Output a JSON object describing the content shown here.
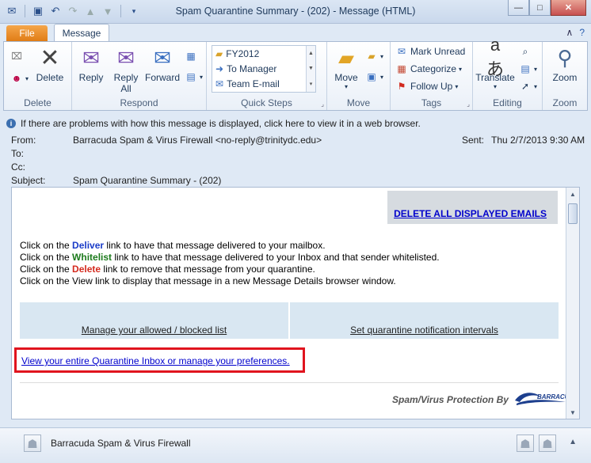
{
  "window": {
    "title": "Spam Quarantine Summary - (202)  -  Message (HTML)"
  },
  "tabs": {
    "file": "File",
    "message": "Message"
  },
  "ribbon": {
    "delete_group": {
      "delete_label": "Delete",
      "group_label": "Delete"
    },
    "respond_group": {
      "reply": "Reply",
      "reply_all_line1": "Reply",
      "reply_all_line2": "All",
      "forward": "Forward",
      "group_label": "Respond"
    },
    "quick_steps": {
      "items": [
        "FY2012",
        "To Manager",
        "Team E-mail"
      ],
      "group_label": "Quick Steps"
    },
    "move_group": {
      "move": "Move",
      "group_label": "Move"
    },
    "tags_group": {
      "mark_unread": "Mark Unread",
      "categorize": "Categorize",
      "follow_up": "Follow Up",
      "group_label": "Tags"
    },
    "editing_group": {
      "translate": "Translate",
      "group_label": "Editing"
    },
    "zoom_group": {
      "zoom": "Zoom",
      "group_label": "Zoom"
    }
  },
  "infobar": {
    "text": "If there are problems with how this message is displayed, click here to view it in a web browser."
  },
  "headers": {
    "from_label": "From:",
    "from_value": "Barracuda Spam & Virus Firewall <no-reply@trinitydc.edu>",
    "sent_label": "Sent:",
    "sent_value": "Thu 2/7/2013 9:30 AM",
    "to_label": "To:",
    "cc_label": "Cc:",
    "subject_label": "Subject:",
    "subject_value": "Spam Quarantine Summary - (202)"
  },
  "body": {
    "delete_all": "DELETE ALL DISPLAYED EMAILS",
    "instructions": {
      "line1_prefix": "Click on the ",
      "line1_word": "Deliver",
      "line1_suffix": " link to have that message delivered to your mailbox.",
      "line2_prefix": "Click on the ",
      "line2_word": "Whitelist",
      "line2_suffix": " link to have that message delivered to your Inbox and that sender whitelisted.",
      "line3_prefix": "Click on the ",
      "line3_word": "Delete",
      "line3_suffix": " link to remove that message from your quarantine.",
      "line4": "Click on the View link to display that message in a new Message Details browser window."
    },
    "manage_list": "Manage your allowed / blocked list",
    "notification_intervals": "Set quarantine notification intervals",
    "view_inbox": "View your entire Quarantine Inbox or manage your preferences.",
    "brand_text": "Spam/Virus Protection By",
    "brand_logo": "BARRACUDA"
  },
  "people_pane": {
    "name": "Barracuda Spam & Virus Firewall"
  }
}
